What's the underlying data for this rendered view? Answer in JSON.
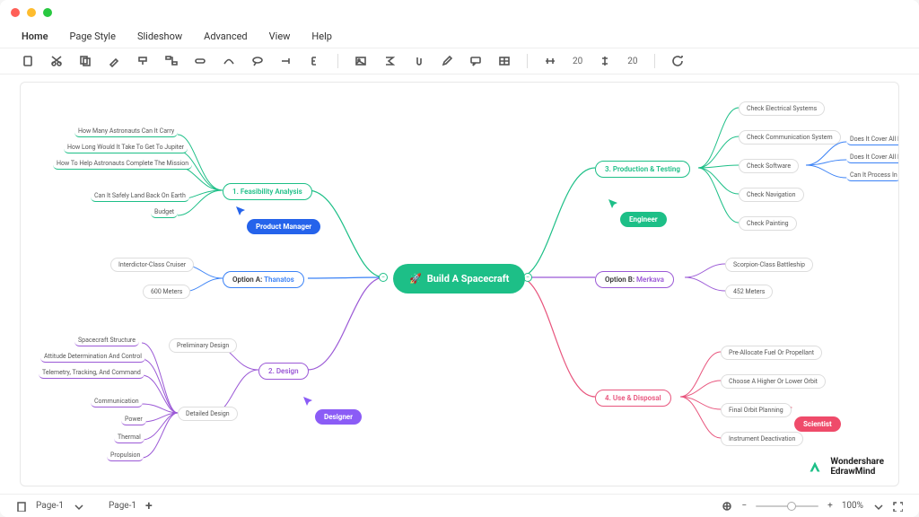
{
  "menu": {
    "home": "Home",
    "pageStyle": "Page Style",
    "slideshow": "Slideshow",
    "advanced": "Advanced",
    "view": "View",
    "help": "Help"
  },
  "toolbar": {
    "num1": "20",
    "num2": "20"
  },
  "central": {
    "label": "Build A Spacecraft",
    "icon": "🚀"
  },
  "roles": {
    "pm": "Product Manager",
    "eng": "Engineer",
    "des": "Designer",
    "sci": "Scientist"
  },
  "nodes": {
    "feasibility": {
      "title": "1. Feasibility Analysis",
      "items": [
        "How Many Astronauts Can It Carry",
        "How Long Would It Take To Get To Jupiter",
        "How To Help Astronauts Complete The Mission",
        "Can It Safely Land Back On Earth",
        "Budget"
      ]
    },
    "optionA": {
      "prefix": "Option A: ",
      "name": "Thanatos",
      "items": [
        "Interdictor-Class Cruiser",
        "600 Meters"
      ]
    },
    "design": {
      "title": "2. Design",
      "sub1": "Preliminary Design",
      "sub2": "Detailed Design",
      "items": [
        "Spacecraft Structure",
        "Attitude Determination And Control",
        "Telemetry, Tracking, And Command",
        "Communication",
        "Power",
        "Thermal",
        "Propulsion"
      ]
    },
    "production": {
      "title": "3. Production & Testing",
      "items": [
        "Check Electrical Systems",
        "Check Communication System",
        "Check Software",
        "Check Navigation",
        "Check Painting"
      ],
      "right": [
        "Does It Cover All I",
        "Does It Cover All I",
        "Can It Process In"
      ]
    },
    "optionB": {
      "prefix": "Option B: ",
      "name": "Merkava",
      "items": [
        "Scorpion-Class Battleship",
        "452 Meters"
      ]
    },
    "disposal": {
      "title": "4. Use & Disposal",
      "items": [
        "Pre-Allocate Fuel Or Propellant",
        "Choose A Higher Or Lower Orbit",
        "Final Orbit Planning",
        "Instrument Deactivation"
      ]
    }
  },
  "brand": {
    "vendor": "Wondershare",
    "product": "EdrawMind"
  },
  "status": {
    "page": "Page-1",
    "pageList": "Page-1",
    "zoom": "100%"
  }
}
